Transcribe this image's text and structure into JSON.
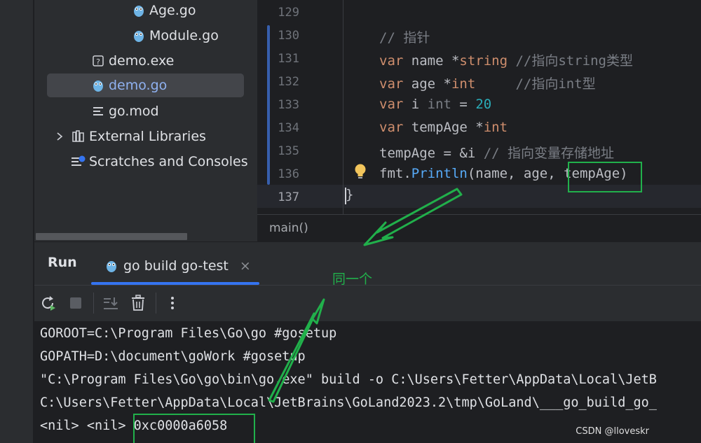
{
  "project_tree": {
    "items": [
      {
        "label": "Age.go",
        "icon": "gopher-icon"
      },
      {
        "label": "Module.go",
        "icon": "gopher-icon"
      },
      {
        "label": "demo.exe",
        "icon": "unknown-file-icon"
      },
      {
        "label": "demo.go",
        "icon": "gopher-icon"
      },
      {
        "label": "go.mod",
        "icon": "text-file-icon"
      },
      {
        "label": "External Libraries",
        "icon": "library-icon"
      },
      {
        "label": "Scratches and Consoles",
        "icon": "scratches-icon"
      }
    ]
  },
  "editor": {
    "line_numbers": [
      "129",
      "130",
      "131",
      "132",
      "133",
      "134",
      "135",
      "136",
      "137"
    ],
    "lines": {
      "l130_comment": "// 指针",
      "l131_kw": "var",
      "l131_rest": " name *",
      "l131_type": "string",
      "l131_comment": " //指向string类型",
      "l132_kw": "var",
      "l132_rest": " age *",
      "l132_type": "int",
      "l132_comment": "     //指向int型",
      "l133_kw": "var",
      "l133_rest": " i ",
      "l133_type": "int",
      "l133_eq": " = ",
      "l133_num": "20",
      "l134_kw": "var",
      "l134_rest": " tempAge *",
      "l134_type": "int",
      "l135_code": "tempAge = &i",
      "l135_comment": " // 指向变量存储地址",
      "l136_pkg": "fmt.",
      "l136_fn": "Println",
      "l136_args": "(name, age, tempAge)",
      "l137_brace": "}"
    },
    "breadcrumb": "main()"
  },
  "run_panel": {
    "title": "Run",
    "tab_label": "go build go-test",
    "tab_close": "×"
  },
  "console": {
    "lines": [
      "GOROOT=C:\\Program Files\\Go\\go #gosetup",
      "GOPATH=D:\\document\\goWork #gosetup",
      "\"C:\\Program Files\\Go\\go\\bin\\go.exe\" build -o C:\\Users\\Fetter\\AppData\\Local\\JetB",
      "C:\\Users\\Fetter\\AppData\\Local\\JetBrains\\GoLand2023.2\\tmp\\GoLand\\___go_build_go_",
      "<nil> <nil> 0xc0000a6058"
    ]
  },
  "annotation": {
    "label": "同一个",
    "color": "#21b04b"
  },
  "watermark": "CSDN @lloveskr",
  "colors": {
    "keyword": "#cf8e6d",
    "number": "#2aacb8",
    "comment": "#7a7e85",
    "function": "#57aaf7",
    "selection_accent": "#3574f0"
  }
}
